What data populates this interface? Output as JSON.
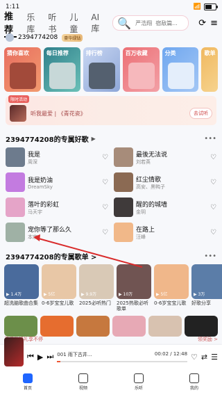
{
  "status": {
    "time": "1:11"
  },
  "topnav": {
    "tabs": [
      {
        "label": "推荐",
        "active": true
      },
      {
        "label": "乐库"
      },
      {
        "label": "听书"
      },
      {
        "label": "儿童"
      },
      {
        "label": "AI库"
      }
    ],
    "search_placeholder": "严浩翔  宿敌篇..."
  },
  "user": {
    "name": "2394774208",
    "vip": "豪华绿钻"
  },
  "cards": [
    {
      "label": "猜你喜欢"
    },
    {
      "label": "每日推荐"
    },
    {
      "label": "排行榜"
    },
    {
      "label": "百万收藏"
    },
    {
      "label": "分类"
    },
    {
      "label": "歌单"
    }
  ],
  "banner": {
    "tag": "限时活动",
    "text": "听我最爱 | 《青花瓷》",
    "button": "去试听"
  },
  "section1": {
    "title": "2394774208的专属好歌",
    "more": "▶"
  },
  "songs": [
    {
      "name": "我是",
      "artist": "周深"
    },
    {
      "name": "最後无法说",
      "artist": "刘若英"
    },
    {
      "name": "我是奶油",
      "artist": "DreamSky"
    },
    {
      "name": "红尘情歌",
      "artist": "高安、黑鸭子"
    },
    {
      "name": "落叶的彩虹",
      "artist": "马天宇"
    },
    {
      "name": "醒的的城墙",
      "artist": "金玥"
    },
    {
      "name": "宠你等了那么久",
      "artist": "本宗"
    },
    {
      "name": "在路上",
      "artist": "汪峰"
    }
  ],
  "section2": {
    "title": "2394774208的专属歌单 >"
  },
  "playlists": [
    {
      "title": "超洗脑歌曲合集",
      "count": "▶ 1.4万"
    },
    {
      "title": "0-6岁宝宝儿歌",
      "count": "▶ 5亿"
    },
    {
      "title": "2025必听热门",
      "count": "▶ 9.9万"
    },
    {
      "title": "2025热歌必听歌单",
      "count": "▶ 10万"
    },
    {
      "title": "0-6岁宝宝儿歌",
      "count": "▶ 5亿"
    },
    {
      "title": "好歌分享",
      "count": "▶ 3万"
    }
  ],
  "notice": {
    "left": "无门槛好礼享不停",
    "right": "领奖励 >"
  },
  "player": {
    "title": "001 雨下古井...",
    "time": "00:02 / 12:48",
    "progress": 0.026
  },
  "bottomnav": [
    {
      "label": "首页",
      "active": true
    },
    {
      "label": "视频"
    },
    {
      "label": "乐听"
    },
    {
      "label": "我的"
    }
  ]
}
